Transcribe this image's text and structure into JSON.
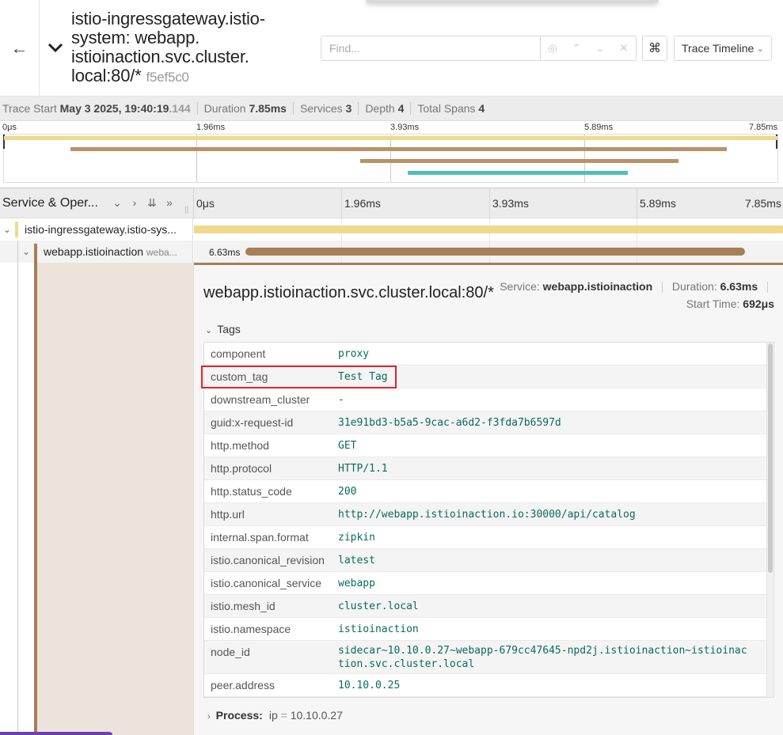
{
  "header": {
    "back_icon": "arrow-left-icon",
    "collapse_icon": "chevron-down-icon",
    "title": "istio-ingressgateway.istio-system: webapp. istioinaction.svc.cluster. local:80/*",
    "trace_id": "f5ef5c0",
    "find_placeholder": "Find...",
    "keyboard_icon": "⌘",
    "view_select": "Trace Timeline"
  },
  "summary": {
    "trace_start_label": "Trace Start",
    "trace_start_value": "May 3 2025, 19:40:19",
    "trace_start_ms": ".144",
    "duration_label": "Duration",
    "duration_value": "7.85ms",
    "services_label": "Services",
    "services_value": "3",
    "depth_label": "Depth",
    "depth_value": "4",
    "total_spans_label": "Total Spans",
    "total_spans_value": "4"
  },
  "minimap": {
    "ticks": [
      "0μs",
      "1.96ms",
      "3.93ms",
      "5.89ms",
      "7.85ms"
    ]
  },
  "timeline": {
    "column_title": "Service & Oper...",
    "ticks": [
      "0μs",
      "1.96ms",
      "3.93ms",
      "5.89ms",
      "7.85ms"
    ]
  },
  "spans": [
    {
      "service": "istio-ingressgateway.istio-sys...",
      "operation": "",
      "color": "#f0d98f"
    },
    {
      "service": "webapp.istioinaction",
      "operation": "weba...",
      "duration_label": "6.63ms",
      "color": "#a77e55"
    }
  ],
  "detail": {
    "title": "webapp.istioinaction.svc.cluster.local:80/*",
    "service_label": "Service:",
    "service_value": "webapp.istioinaction",
    "duration_label": "Duration:",
    "duration_value": "6.63ms",
    "start_time_label": "Start Time:",
    "start_time_value": "692μs",
    "tags_label": "Tags",
    "tags": [
      {
        "key": "component",
        "value": "proxy"
      },
      {
        "key": "custom_tag",
        "value": "Test Tag"
      },
      {
        "key": "downstream_cluster",
        "value": "-"
      },
      {
        "key": "guid:x-request-id",
        "value": "31e91bd3-b5a5-9cac-a6d2-f3fda7b6597d"
      },
      {
        "key": "http.method",
        "value": "GET"
      },
      {
        "key": "http.protocol",
        "value": "HTTP/1.1"
      },
      {
        "key": "http.status_code",
        "value": "200"
      },
      {
        "key": "http.url",
        "value": "http://webapp.istioinaction.io:30000/api/catalog"
      },
      {
        "key": "internal.span.format",
        "value": "zipkin"
      },
      {
        "key": "istio.canonical_revision",
        "value": "latest"
      },
      {
        "key": "istio.canonical_service",
        "value": "webapp"
      },
      {
        "key": "istio.mesh_id",
        "value": "cluster.local"
      },
      {
        "key": "istio.namespace",
        "value": "istioinaction"
      },
      {
        "key": "node_id",
        "value": "sidecar~10.10.0.27~webapp-679cc47645-npd2j.istioinaction~istioinaction.svc.cluster.local"
      },
      {
        "key": "peer.address",
        "value": "10.10.0.25"
      }
    ],
    "process_label": "Process:",
    "process_key": "ip",
    "process_eq": "=",
    "process_value": "10.10.0.27"
  },
  "colors": {
    "ingress": "#f0d98f",
    "webapp": "#a77e55",
    "third": "#4cc0c0",
    "highlight": "#e0232e"
  }
}
